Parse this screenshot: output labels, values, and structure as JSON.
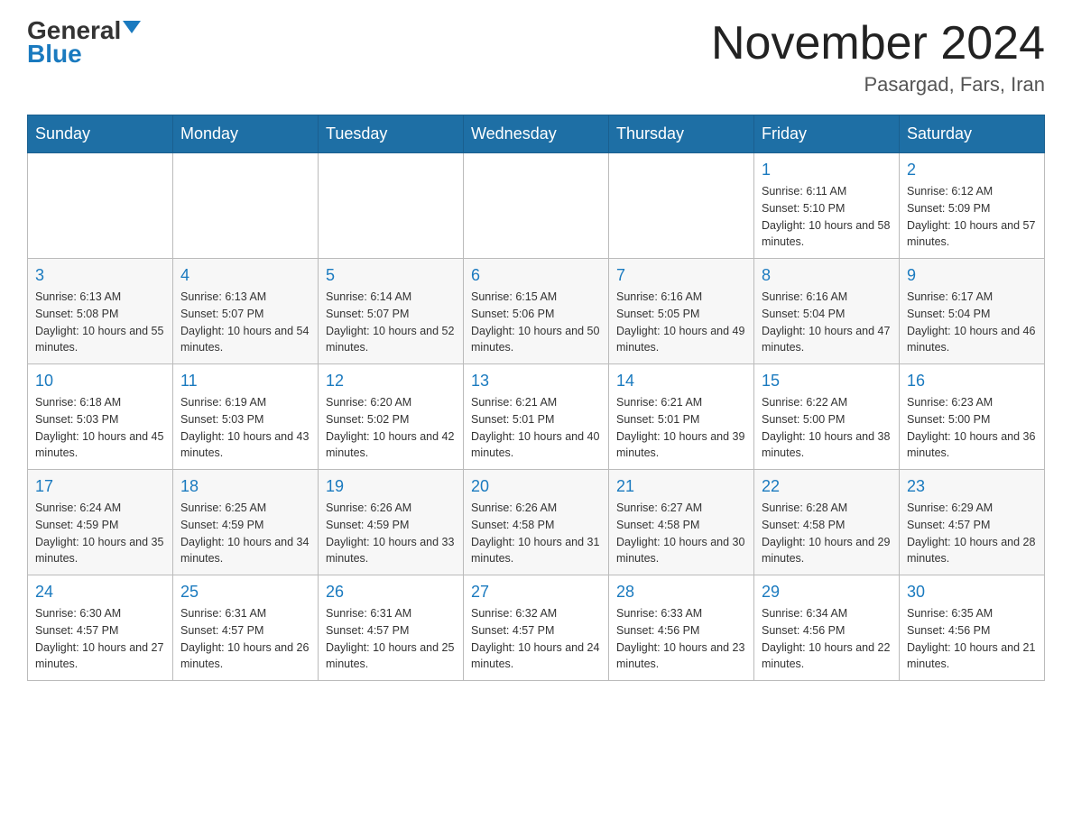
{
  "header": {
    "logo_general": "General",
    "logo_blue": "Blue",
    "month_title": "November 2024",
    "location": "Pasargad, Fars, Iran"
  },
  "days_of_week": [
    "Sunday",
    "Monday",
    "Tuesday",
    "Wednesday",
    "Thursday",
    "Friday",
    "Saturday"
  ],
  "weeks": [
    {
      "days": [
        {
          "number": "",
          "info": ""
        },
        {
          "number": "",
          "info": ""
        },
        {
          "number": "",
          "info": ""
        },
        {
          "number": "",
          "info": ""
        },
        {
          "number": "",
          "info": ""
        },
        {
          "number": "1",
          "info": "Sunrise: 6:11 AM\nSunset: 5:10 PM\nDaylight: 10 hours and 58 minutes."
        },
        {
          "number": "2",
          "info": "Sunrise: 6:12 AM\nSunset: 5:09 PM\nDaylight: 10 hours and 57 minutes."
        }
      ]
    },
    {
      "days": [
        {
          "number": "3",
          "info": "Sunrise: 6:13 AM\nSunset: 5:08 PM\nDaylight: 10 hours and 55 minutes."
        },
        {
          "number": "4",
          "info": "Sunrise: 6:13 AM\nSunset: 5:07 PM\nDaylight: 10 hours and 54 minutes."
        },
        {
          "number": "5",
          "info": "Sunrise: 6:14 AM\nSunset: 5:07 PM\nDaylight: 10 hours and 52 minutes."
        },
        {
          "number": "6",
          "info": "Sunrise: 6:15 AM\nSunset: 5:06 PM\nDaylight: 10 hours and 50 minutes."
        },
        {
          "number": "7",
          "info": "Sunrise: 6:16 AM\nSunset: 5:05 PM\nDaylight: 10 hours and 49 minutes."
        },
        {
          "number": "8",
          "info": "Sunrise: 6:16 AM\nSunset: 5:04 PM\nDaylight: 10 hours and 47 minutes."
        },
        {
          "number": "9",
          "info": "Sunrise: 6:17 AM\nSunset: 5:04 PM\nDaylight: 10 hours and 46 minutes."
        }
      ]
    },
    {
      "days": [
        {
          "number": "10",
          "info": "Sunrise: 6:18 AM\nSunset: 5:03 PM\nDaylight: 10 hours and 45 minutes."
        },
        {
          "number": "11",
          "info": "Sunrise: 6:19 AM\nSunset: 5:03 PM\nDaylight: 10 hours and 43 minutes."
        },
        {
          "number": "12",
          "info": "Sunrise: 6:20 AM\nSunset: 5:02 PM\nDaylight: 10 hours and 42 minutes."
        },
        {
          "number": "13",
          "info": "Sunrise: 6:21 AM\nSunset: 5:01 PM\nDaylight: 10 hours and 40 minutes."
        },
        {
          "number": "14",
          "info": "Sunrise: 6:21 AM\nSunset: 5:01 PM\nDaylight: 10 hours and 39 minutes."
        },
        {
          "number": "15",
          "info": "Sunrise: 6:22 AM\nSunset: 5:00 PM\nDaylight: 10 hours and 38 minutes."
        },
        {
          "number": "16",
          "info": "Sunrise: 6:23 AM\nSunset: 5:00 PM\nDaylight: 10 hours and 36 minutes."
        }
      ]
    },
    {
      "days": [
        {
          "number": "17",
          "info": "Sunrise: 6:24 AM\nSunset: 4:59 PM\nDaylight: 10 hours and 35 minutes."
        },
        {
          "number": "18",
          "info": "Sunrise: 6:25 AM\nSunset: 4:59 PM\nDaylight: 10 hours and 34 minutes."
        },
        {
          "number": "19",
          "info": "Sunrise: 6:26 AM\nSunset: 4:59 PM\nDaylight: 10 hours and 33 minutes."
        },
        {
          "number": "20",
          "info": "Sunrise: 6:26 AM\nSunset: 4:58 PM\nDaylight: 10 hours and 31 minutes."
        },
        {
          "number": "21",
          "info": "Sunrise: 6:27 AM\nSunset: 4:58 PM\nDaylight: 10 hours and 30 minutes."
        },
        {
          "number": "22",
          "info": "Sunrise: 6:28 AM\nSunset: 4:58 PM\nDaylight: 10 hours and 29 minutes."
        },
        {
          "number": "23",
          "info": "Sunrise: 6:29 AM\nSunset: 4:57 PM\nDaylight: 10 hours and 28 minutes."
        }
      ]
    },
    {
      "days": [
        {
          "number": "24",
          "info": "Sunrise: 6:30 AM\nSunset: 4:57 PM\nDaylight: 10 hours and 27 minutes."
        },
        {
          "number": "25",
          "info": "Sunrise: 6:31 AM\nSunset: 4:57 PM\nDaylight: 10 hours and 26 minutes."
        },
        {
          "number": "26",
          "info": "Sunrise: 6:31 AM\nSunset: 4:57 PM\nDaylight: 10 hours and 25 minutes."
        },
        {
          "number": "27",
          "info": "Sunrise: 6:32 AM\nSunset: 4:57 PM\nDaylight: 10 hours and 24 minutes."
        },
        {
          "number": "28",
          "info": "Sunrise: 6:33 AM\nSunset: 4:56 PM\nDaylight: 10 hours and 23 minutes."
        },
        {
          "number": "29",
          "info": "Sunrise: 6:34 AM\nSunset: 4:56 PM\nDaylight: 10 hours and 22 minutes."
        },
        {
          "number": "30",
          "info": "Sunrise: 6:35 AM\nSunset: 4:56 PM\nDaylight: 10 hours and 21 minutes."
        }
      ]
    }
  ]
}
